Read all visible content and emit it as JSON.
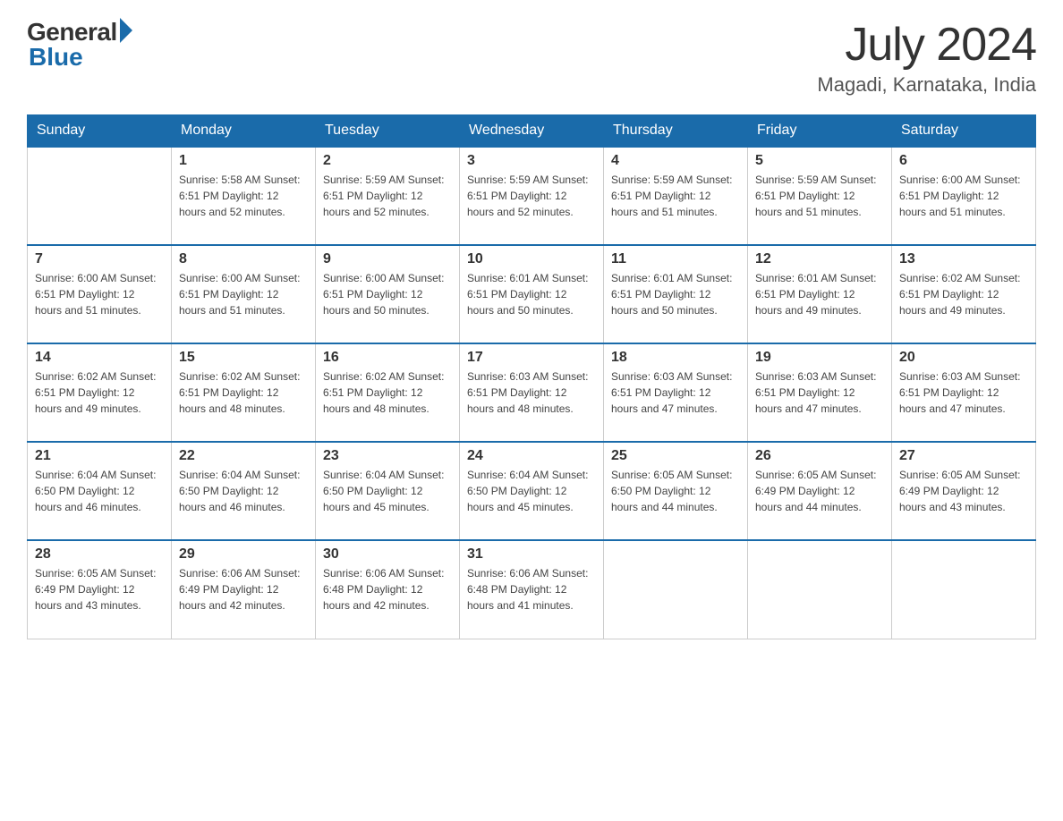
{
  "header": {
    "logo": {
      "general": "General",
      "blue": "Blue"
    },
    "title": "July 2024",
    "location": "Magadi, Karnataka, India"
  },
  "calendar": {
    "days_of_week": [
      "Sunday",
      "Monday",
      "Tuesday",
      "Wednesday",
      "Thursday",
      "Friday",
      "Saturday"
    ],
    "weeks": [
      [
        {
          "day": "",
          "info": ""
        },
        {
          "day": "1",
          "info": "Sunrise: 5:58 AM\nSunset: 6:51 PM\nDaylight: 12 hours\nand 52 minutes."
        },
        {
          "day": "2",
          "info": "Sunrise: 5:59 AM\nSunset: 6:51 PM\nDaylight: 12 hours\nand 52 minutes."
        },
        {
          "day": "3",
          "info": "Sunrise: 5:59 AM\nSunset: 6:51 PM\nDaylight: 12 hours\nand 52 minutes."
        },
        {
          "day": "4",
          "info": "Sunrise: 5:59 AM\nSunset: 6:51 PM\nDaylight: 12 hours\nand 51 minutes."
        },
        {
          "day": "5",
          "info": "Sunrise: 5:59 AM\nSunset: 6:51 PM\nDaylight: 12 hours\nand 51 minutes."
        },
        {
          "day": "6",
          "info": "Sunrise: 6:00 AM\nSunset: 6:51 PM\nDaylight: 12 hours\nand 51 minutes."
        }
      ],
      [
        {
          "day": "7",
          "info": "Sunrise: 6:00 AM\nSunset: 6:51 PM\nDaylight: 12 hours\nand 51 minutes."
        },
        {
          "day": "8",
          "info": "Sunrise: 6:00 AM\nSunset: 6:51 PM\nDaylight: 12 hours\nand 51 minutes."
        },
        {
          "day": "9",
          "info": "Sunrise: 6:00 AM\nSunset: 6:51 PM\nDaylight: 12 hours\nand 50 minutes."
        },
        {
          "day": "10",
          "info": "Sunrise: 6:01 AM\nSunset: 6:51 PM\nDaylight: 12 hours\nand 50 minutes."
        },
        {
          "day": "11",
          "info": "Sunrise: 6:01 AM\nSunset: 6:51 PM\nDaylight: 12 hours\nand 50 minutes."
        },
        {
          "day": "12",
          "info": "Sunrise: 6:01 AM\nSunset: 6:51 PM\nDaylight: 12 hours\nand 49 minutes."
        },
        {
          "day": "13",
          "info": "Sunrise: 6:02 AM\nSunset: 6:51 PM\nDaylight: 12 hours\nand 49 minutes."
        }
      ],
      [
        {
          "day": "14",
          "info": "Sunrise: 6:02 AM\nSunset: 6:51 PM\nDaylight: 12 hours\nand 49 minutes."
        },
        {
          "day": "15",
          "info": "Sunrise: 6:02 AM\nSunset: 6:51 PM\nDaylight: 12 hours\nand 48 minutes."
        },
        {
          "day": "16",
          "info": "Sunrise: 6:02 AM\nSunset: 6:51 PM\nDaylight: 12 hours\nand 48 minutes."
        },
        {
          "day": "17",
          "info": "Sunrise: 6:03 AM\nSunset: 6:51 PM\nDaylight: 12 hours\nand 48 minutes."
        },
        {
          "day": "18",
          "info": "Sunrise: 6:03 AM\nSunset: 6:51 PM\nDaylight: 12 hours\nand 47 minutes."
        },
        {
          "day": "19",
          "info": "Sunrise: 6:03 AM\nSunset: 6:51 PM\nDaylight: 12 hours\nand 47 minutes."
        },
        {
          "day": "20",
          "info": "Sunrise: 6:03 AM\nSunset: 6:51 PM\nDaylight: 12 hours\nand 47 minutes."
        }
      ],
      [
        {
          "day": "21",
          "info": "Sunrise: 6:04 AM\nSunset: 6:50 PM\nDaylight: 12 hours\nand 46 minutes."
        },
        {
          "day": "22",
          "info": "Sunrise: 6:04 AM\nSunset: 6:50 PM\nDaylight: 12 hours\nand 46 minutes."
        },
        {
          "day": "23",
          "info": "Sunrise: 6:04 AM\nSunset: 6:50 PM\nDaylight: 12 hours\nand 45 minutes."
        },
        {
          "day": "24",
          "info": "Sunrise: 6:04 AM\nSunset: 6:50 PM\nDaylight: 12 hours\nand 45 minutes."
        },
        {
          "day": "25",
          "info": "Sunrise: 6:05 AM\nSunset: 6:50 PM\nDaylight: 12 hours\nand 44 minutes."
        },
        {
          "day": "26",
          "info": "Sunrise: 6:05 AM\nSunset: 6:49 PM\nDaylight: 12 hours\nand 44 minutes."
        },
        {
          "day": "27",
          "info": "Sunrise: 6:05 AM\nSunset: 6:49 PM\nDaylight: 12 hours\nand 43 minutes."
        }
      ],
      [
        {
          "day": "28",
          "info": "Sunrise: 6:05 AM\nSunset: 6:49 PM\nDaylight: 12 hours\nand 43 minutes."
        },
        {
          "day": "29",
          "info": "Sunrise: 6:06 AM\nSunset: 6:49 PM\nDaylight: 12 hours\nand 42 minutes."
        },
        {
          "day": "30",
          "info": "Sunrise: 6:06 AM\nSunset: 6:48 PM\nDaylight: 12 hours\nand 42 minutes."
        },
        {
          "day": "31",
          "info": "Sunrise: 6:06 AM\nSunset: 6:48 PM\nDaylight: 12 hours\nand 41 minutes."
        },
        {
          "day": "",
          "info": ""
        },
        {
          "day": "",
          "info": ""
        },
        {
          "day": "",
          "info": ""
        }
      ]
    ]
  }
}
